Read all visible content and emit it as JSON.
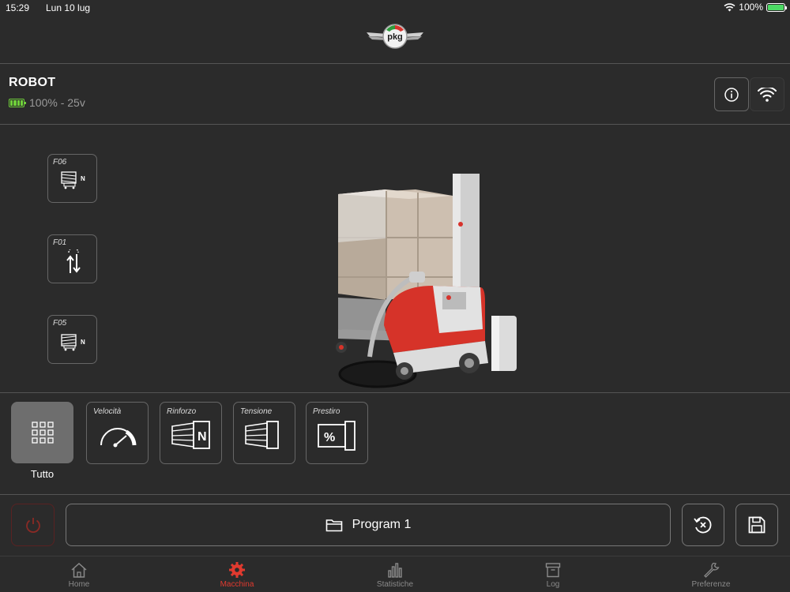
{
  "status_bar": {
    "time": "15:29",
    "date": "Lun 10 lug",
    "battery": "100%"
  },
  "header": {
    "logo_text": "pkg"
  },
  "robot": {
    "title": "ROBOT",
    "battery_text": "100% - 25v",
    "battery_level": 1.0
  },
  "functions": [
    {
      "code": "F06",
      "icon": "wrap-reinforce-icon"
    },
    {
      "code": "F01",
      "icon": "up-down-arrows-icon"
    },
    {
      "code": "F05",
      "icon": "wrap-tension-icon"
    }
  ],
  "params": {
    "all_label": "Tutto",
    "items": [
      {
        "label": "Velocità",
        "icon": "speedometer-icon"
      },
      {
        "label": "Rinforzo",
        "icon": "reinforce-icon"
      },
      {
        "label": "Tensione",
        "icon": "tension-icon"
      },
      {
        "label": "Prestiro",
        "icon": "prestretch-icon"
      }
    ]
  },
  "program": {
    "label": "Program 1"
  },
  "tabs": [
    {
      "label": "Home",
      "icon": "home-icon"
    },
    {
      "label": "Macchina",
      "icon": "gear-icon",
      "active": true
    },
    {
      "label": "Statistiche",
      "icon": "bar-chart-icon"
    },
    {
      "label": "Log",
      "icon": "archive-icon"
    },
    {
      "label": "Preferenze",
      "icon": "wrench-icon"
    }
  ],
  "colors": {
    "background": "#2b2b2b",
    "accent": "#e03a2f",
    "battery_green": "#6fcf3a",
    "tile_active": "#6e6e6e"
  }
}
